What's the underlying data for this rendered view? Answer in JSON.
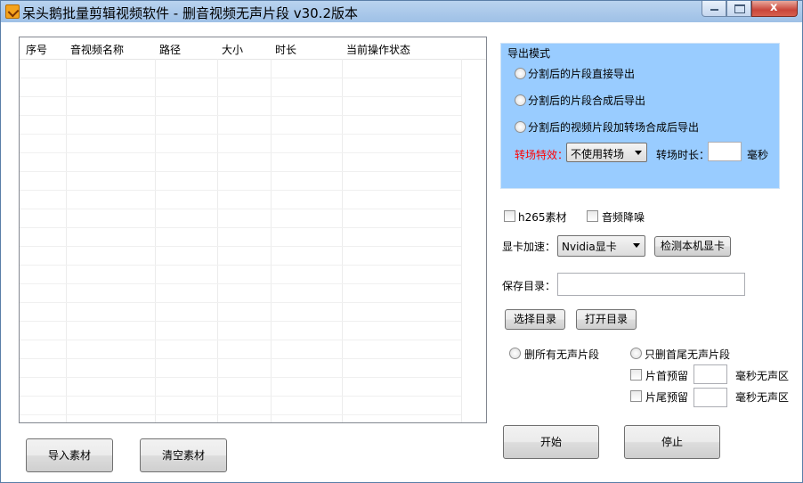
{
  "window": {
    "title": "呆头鹅批量剪辑视频软件 -  删音视频无声片段  v30.2版本",
    "close_glyph": "x"
  },
  "table": {
    "columns": [
      "序号",
      "音视频名称",
      "路径",
      "大小",
      "时长",
      "当前操作状态"
    ]
  },
  "bottom": {
    "import_label": "导入素材",
    "clear_label": "清空素材"
  },
  "export_mode": {
    "title": "导出模式",
    "options": [
      "分割后的片段直接导出",
      "分割后的片段合成后导出",
      "分割后的视频片段加转场合成后导出"
    ],
    "transition_label": "转场特效：",
    "transition_value": "不使用转场",
    "transition_duration_label": "转场时长：",
    "transition_duration_value": "",
    "ms_unit": "毫秒"
  },
  "options": {
    "h265_label": "h265素材",
    "denoise_label": "音频降噪",
    "gpu_label": "显卡加速：",
    "gpu_value": "Nvidia显卡",
    "detect_gpu_label": "检测本机显卡",
    "save_dir_label": "保存目录：",
    "save_dir_value": "",
    "choose_dir_label": "选择目录",
    "open_dir_label": "打开目录"
  },
  "silence": {
    "delete_all_label": "删所有无声片段",
    "delete_ends_label": "只删首尾无声片段",
    "head_keep_label": "片首预留",
    "head_keep_value": "",
    "head_unit": "毫秒无声区",
    "tail_keep_label": "片尾预留",
    "tail_keep_value": "",
    "tail_unit": "毫秒无声区"
  },
  "actions": {
    "start_label": "开始",
    "stop_label": "停止"
  },
  "colors": {
    "group_bg": "#99ccff",
    "transition_label": "#ff0000"
  }
}
